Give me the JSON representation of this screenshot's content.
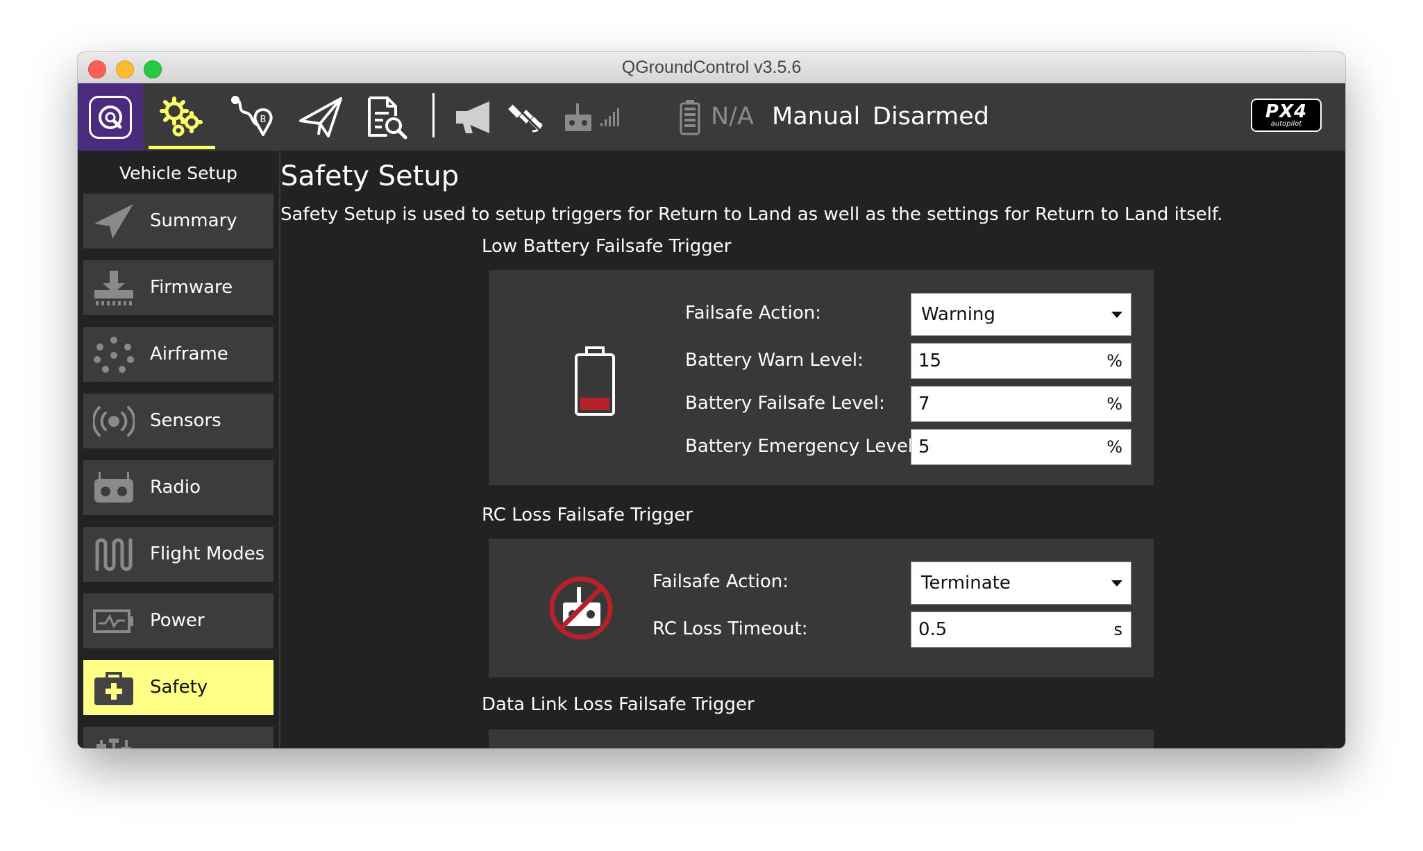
{
  "window": {
    "title": "QGroundControl v3.5.6"
  },
  "toolbar": {
    "items": [
      {
        "icon": "qgc-logo-icon"
      },
      {
        "icon": "gears-icon",
        "active": true
      },
      {
        "icon": "plan-waypoint-icon"
      },
      {
        "icon": "paper-plane-icon"
      },
      {
        "icon": "analyze-document-icon"
      }
    ],
    "status_icons": [
      "megaphone-icon",
      "satellite-icon",
      "rc-transmitter-icon",
      "signal-bars-icon",
      "battery-icon"
    ],
    "battery_text": "N/A",
    "flight_mode": "Manual",
    "arm_state": "Disarmed",
    "brand": {
      "main": "PX4",
      "sub": "autopilot"
    },
    "active_color": "#ffff66"
  },
  "sidebar": {
    "title": "Vehicle Setup",
    "items": [
      {
        "label": "Summary",
        "icon": "paper-plane-icon"
      },
      {
        "label": "Firmware",
        "icon": "firmware-download-icon"
      },
      {
        "label": "Airframe",
        "icon": "airframe-dots-icon"
      },
      {
        "label": "Sensors",
        "icon": "sensors-radio-icon"
      },
      {
        "label": "Radio",
        "icon": "radio-transmitter-icon"
      },
      {
        "label": "Flight Modes",
        "icon": "flight-modes-wave-icon"
      },
      {
        "label": "Power",
        "icon": "power-battery-icon"
      },
      {
        "label": "Safety",
        "icon": "first-aid-kit-icon",
        "active": true
      }
    ],
    "active_color": "#ffff88"
  },
  "main": {
    "title": "Safety Setup",
    "description": "Safety Setup is used to setup triggers for Return to Land as well as the settings for Return to Land itself.",
    "low_battery": {
      "heading": "Low Battery Failsafe Trigger",
      "icon": "battery-low-icon",
      "action_label": "Failsafe Action:",
      "action_value": "Warning",
      "warn_label": "Battery Warn Level:",
      "warn_value": "15",
      "warn_unit": "%",
      "failsafe_label": "Battery Failsafe Level:",
      "failsafe_value": "7",
      "failsafe_unit": "%",
      "emergency_label": "Battery Emergency Level:",
      "emergency_value": "5",
      "emergency_unit": "%"
    },
    "rc_loss": {
      "heading": "RC Loss Failsafe Trigger",
      "icon": "rc-loss-prohibited-icon",
      "action_label": "Failsafe Action:",
      "action_value": "Terminate",
      "timeout_label": "RC Loss Timeout:",
      "timeout_value": "0.5",
      "timeout_unit": "s"
    },
    "data_link_loss": {
      "heading": "Data Link Loss Failsafe Trigger"
    }
  }
}
